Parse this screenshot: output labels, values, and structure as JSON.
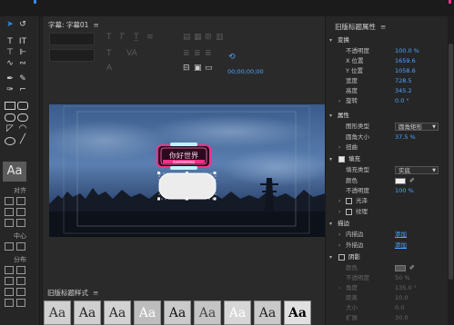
{
  "colors": {
    "accent": "#2d8ceb",
    "value_blue": "#4da3ff",
    "neon_pink": "#ff2e88"
  },
  "tools_panel": {
    "align_label": "对齐",
    "center_label": "中心",
    "distribute_label": "分布",
    "style_sample": "Aa"
  },
  "title_panel": {
    "tab_label": "字幕: 字幕01",
    "menu_icon": "≡",
    "timecode": "00;00;00;00",
    "neon_sign_text": "你好世界",
    "neon_sub_text": "欢迎来到我的频道"
  },
  "styles_panel": {
    "title": "旧版标题样式",
    "menu_icon": "≡",
    "tiles": [
      "Aa",
      "Aa",
      "Aa",
      "Aa",
      "Aa",
      "Aa",
      "Aa",
      "Aa",
      "Aa"
    ]
  },
  "properties": {
    "title": "旧版标题属性",
    "menu_icon": "≡",
    "transform": {
      "label": "变换",
      "opacity_label": "不透明度",
      "opacity": "100.0 %",
      "x_label": "X 位置",
      "x": "1659.6",
      "y_label": "Y 位置",
      "y": "1058.6",
      "width_label": "宽度",
      "width": "728.5",
      "height_label": "高度",
      "height": "345.2",
      "rotation_label": "旋转",
      "rotation": "0.0 °"
    },
    "properties": {
      "label": "属性",
      "shape_type_label": "图形类型",
      "shape_type": "圆角矩形",
      "corner_label": "圆角大小",
      "corner": "37.5 %",
      "distort_label": "扭曲"
    },
    "fill": {
      "label": "填充",
      "fill_type_label": "填充类型",
      "fill_type": "实底",
      "color_label": "颜色",
      "opacity_label": "不透明度",
      "opacity": "100 %",
      "sheen_label": "光泽",
      "texture_label": "纹理"
    },
    "stroke": {
      "label": "描边",
      "inner_label": "内描边",
      "inner_action": "添加",
      "outer_label": "外描边",
      "outer_action": "添加"
    },
    "shadow": {
      "label": "阴影",
      "color_label": "颜色",
      "opacity_label": "不透明度",
      "opacity": "50 %",
      "angle_label": "角度",
      "angle": "135.0 °",
      "distance_label": "距离",
      "distance": "10.0",
      "size_label": "大小",
      "size": "0.0",
      "spread_label": "扩展",
      "spread": "30.0"
    }
  }
}
